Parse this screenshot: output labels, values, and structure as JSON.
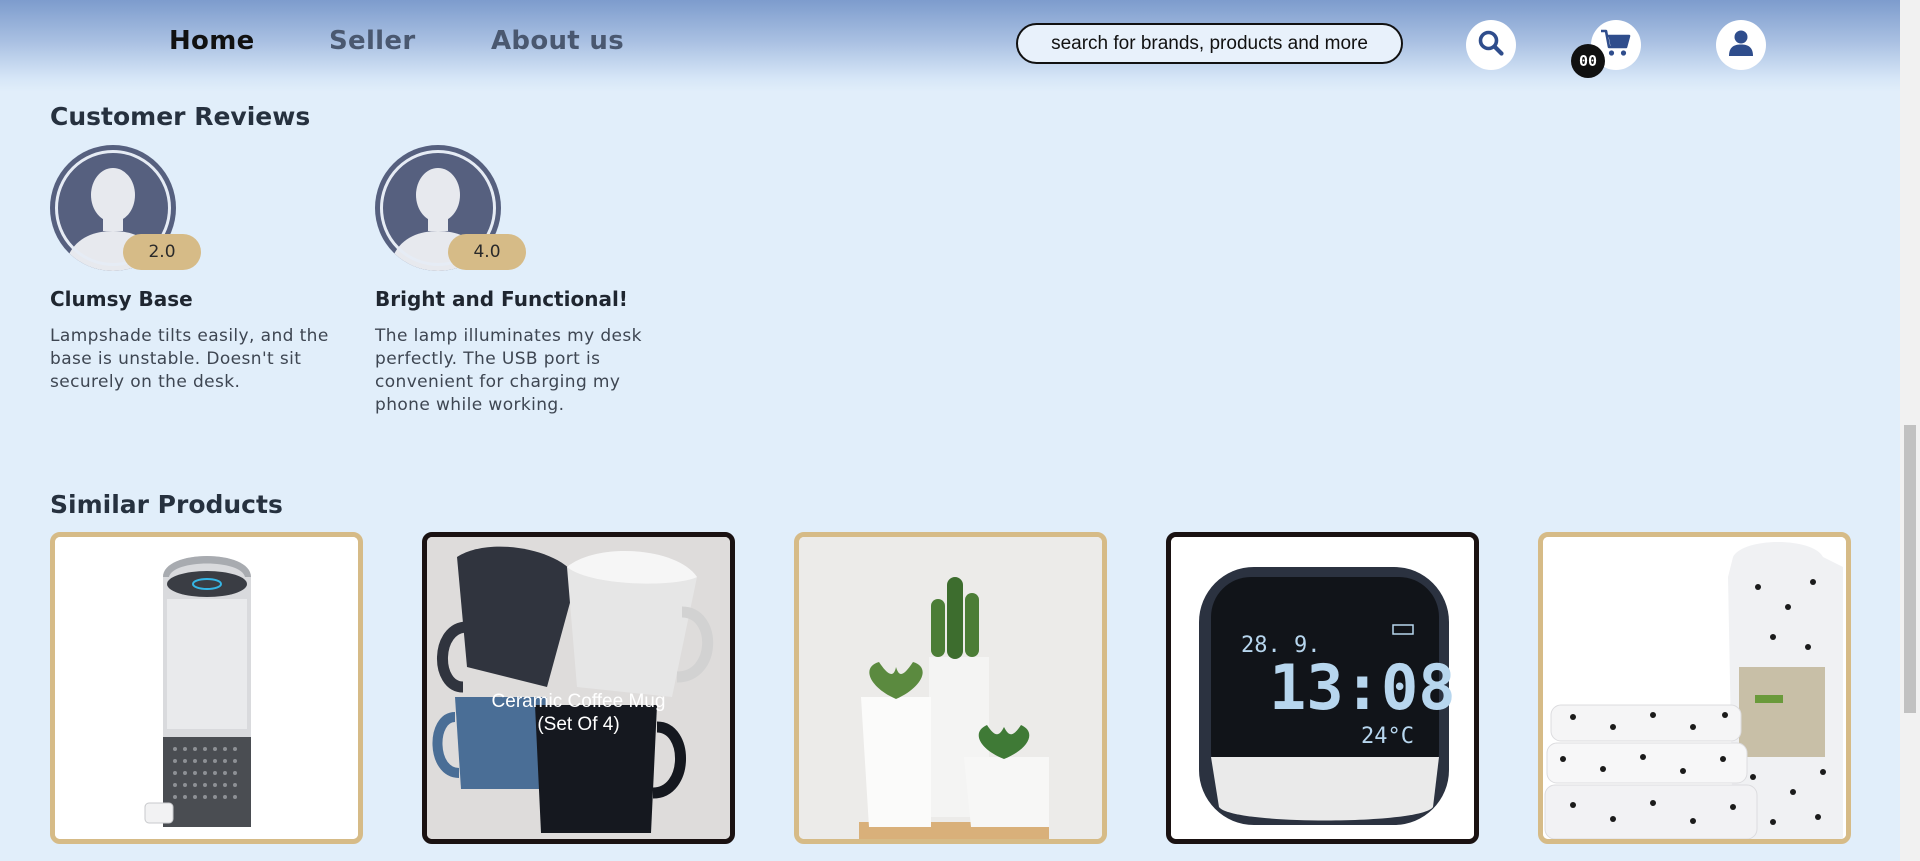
{
  "nav": {
    "links": [
      {
        "label": "Home",
        "active": true
      },
      {
        "label": "Seller",
        "active": false
      },
      {
        "label": "About us",
        "active": false
      }
    ],
    "search_placeholder": "search for brands, products and more",
    "cart_count": "00",
    "icons": [
      "search-icon",
      "cart-icon",
      "user-icon"
    ]
  },
  "reviews_section": {
    "title": "Customer Reviews",
    "reviews": [
      {
        "rating": "2.0",
        "title": "Clumsy Base",
        "text": "Lampshade tilts easily, and the base is unstable. Doesn't sit securely on the desk."
      },
      {
        "rating": "4.0",
        "title": "Bright and Functional!",
        "text": "The lamp illuminates my desk perfectly. The USB port is convenient for charging my phone while working."
      }
    ]
  },
  "similar_section": {
    "title": "Similar Products",
    "products": [
      {
        "image": "air-purifier",
        "name": ""
      },
      {
        "image": "coffee-mugs",
        "name": "Ceramic Coffee Mug (Set Of 4)"
      },
      {
        "image": "potted-succulents",
        "name": ""
      },
      {
        "image": "digital-alarm-clock",
        "name": ""
      },
      {
        "image": "polka-dot-bed-sheets",
        "name": ""
      }
    ]
  },
  "colors": {
    "background": "#e1eefa",
    "accent_gold": "#d6bb87",
    "avatar": "#56607f",
    "icon_blue": "#2f4d8c"
  }
}
